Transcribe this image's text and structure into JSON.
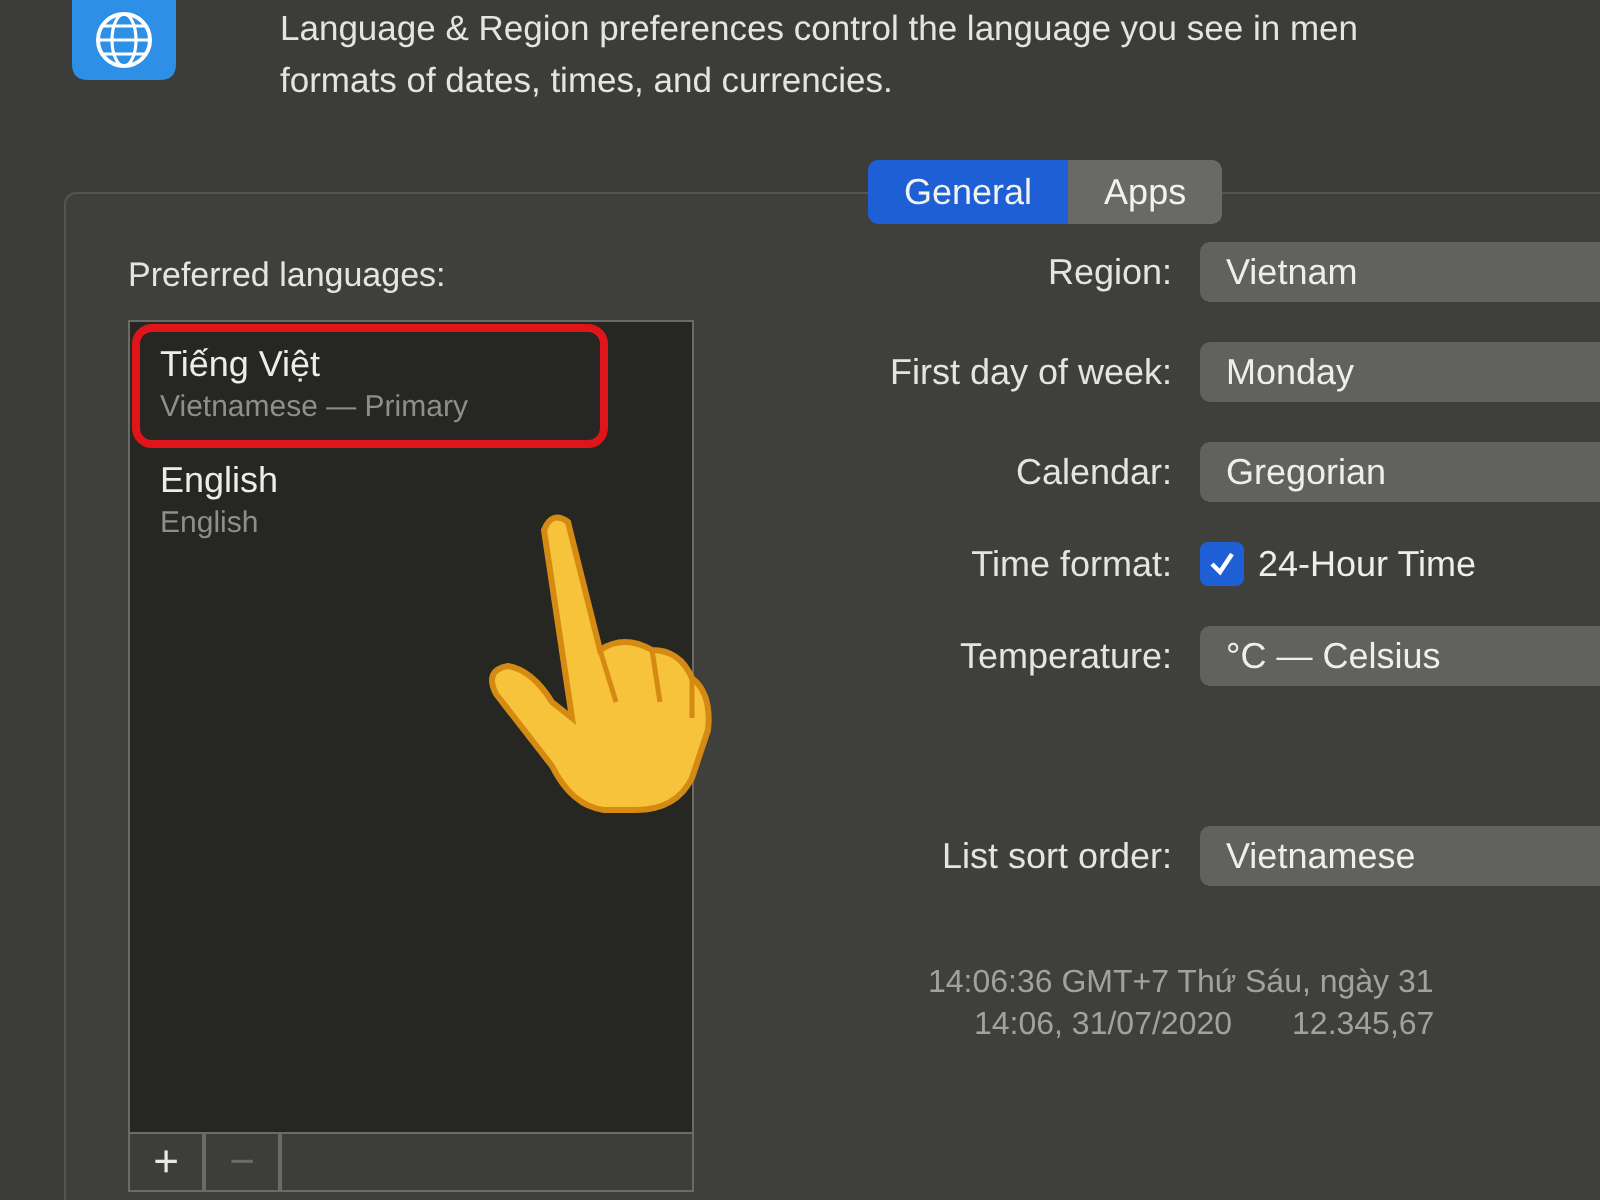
{
  "description": [
    "Language & Region preferences control the language you see in men",
    "formats of dates, times, and currencies."
  ],
  "tabs": [
    {
      "label": "General",
      "selected": true
    },
    {
      "label": "Apps",
      "selected": false
    }
  ],
  "preferred_languages": {
    "title": "Preferred languages:",
    "items": [
      {
        "name": "Tiếng Việt",
        "detail": "Vietnamese — Primary",
        "highlighted": true
      },
      {
        "name": "English",
        "detail": "English",
        "highlighted": false
      }
    ],
    "add_button": {
      "label": "+",
      "disabled": false
    },
    "remove_button": {
      "label": "−",
      "disabled": true
    }
  },
  "settings": [
    {
      "kind": "popup",
      "label": "Region:",
      "value": "Vietnam"
    },
    {
      "kind": "popup",
      "label": "First day of week:",
      "value": "Monday"
    },
    {
      "kind": "popup",
      "label": "Calendar:",
      "value": "Gregorian"
    },
    {
      "kind": "checkbox",
      "label": "Time format:",
      "value": "24-Hour Time",
      "checked": true
    },
    {
      "kind": "popup",
      "label": "Temperature:",
      "value": "°C — Celsius"
    }
  ],
  "list_sort_order": {
    "label": "List sort order:",
    "value": "Vietnamese"
  },
  "sample": {
    "line_1": "14:06:36 GMT+7 Thứ Sáu, ngày 31",
    "date": "14:06, 31/07/2020",
    "number": "12.345,67"
  }
}
